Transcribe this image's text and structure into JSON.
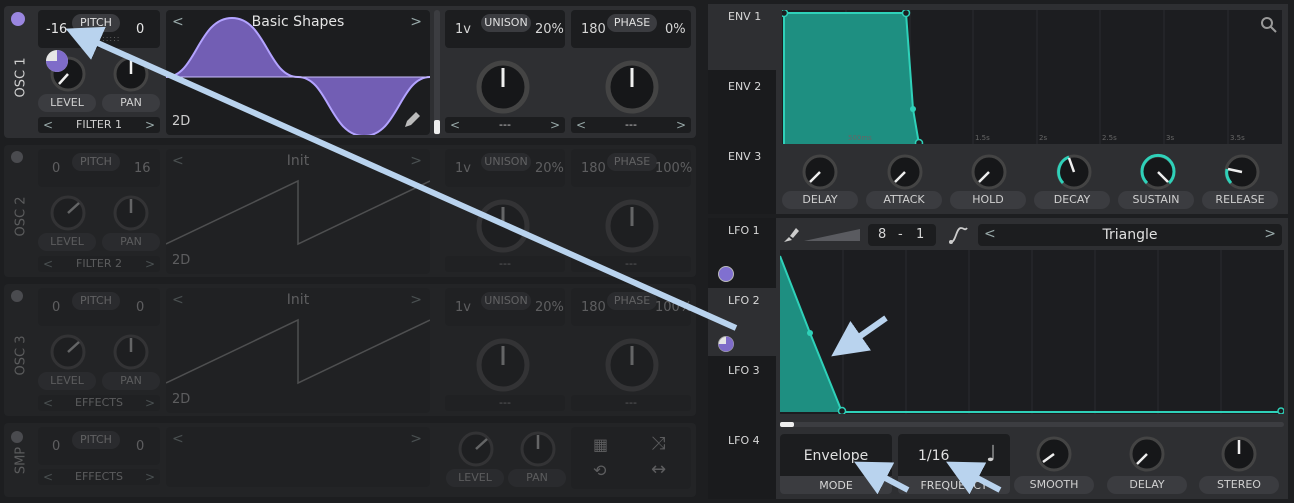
{
  "osc1": {
    "side_label": "OSC 1",
    "pitch_label": "PITCH",
    "pitch_left": "-16",
    "pitch_right": "0",
    "level_label": "LEVEL",
    "pan_label": "PAN",
    "dest": "FILTER 1",
    "wavetable_name": "Basic Shapes",
    "mode": "2D",
    "unison_label": "UNISON",
    "unison_voices": "1v",
    "unison_detune": "20%",
    "phase_label": "PHASE",
    "phase_value": "180",
    "phase_random": "0%",
    "sel1": "---",
    "sel2": "---"
  },
  "osc2": {
    "side_label": "OSC 2",
    "pitch_label": "PITCH",
    "pitch_left": "0",
    "pitch_right": "16",
    "level_label": "LEVEL",
    "pan_label": "PAN",
    "dest": "FILTER 2",
    "wavetable_name": "Init",
    "mode": "2D",
    "unison_label": "UNISON",
    "unison_voices": "1v",
    "unison_detune": "20%",
    "phase_label": "PHASE",
    "phase_value": "180",
    "phase_random": "100%",
    "sel1": "---",
    "sel2": "---"
  },
  "osc3": {
    "side_label": "OSC 3",
    "pitch_label": "PITCH",
    "pitch_left": "0",
    "pitch_right": "0",
    "level_label": "LEVEL",
    "pan_label": "PAN",
    "dest": "EFFECTS",
    "wavetable_name": "Init",
    "mode": "2D",
    "unison_label": "UNISON",
    "unison_voices": "1v",
    "unison_detune": "20%",
    "phase_label": "PHASE",
    "phase_value": "180",
    "phase_random": "100%",
    "sel1": "---",
    "sel2": "---"
  },
  "smp": {
    "side_label": "SMP",
    "pitch_label": "PITCH",
    "pitch_left": "0",
    "pitch_right": "0",
    "level_label": "LEVEL",
    "pan_label": "PAN",
    "dest": "EFFECTS"
  },
  "env": {
    "tabs": [
      "ENV 1",
      "ENV 2",
      "ENV 3"
    ],
    "time_marks": [
      "500ms",
      "1.5s",
      "2s",
      "2.5s",
      "3s",
      "3.5s"
    ],
    "knobs": [
      "DELAY",
      "ATTACK",
      "HOLD",
      "DECAY",
      "SUSTAIN",
      "RELEASE"
    ]
  },
  "lfo": {
    "tabs": [
      "LFO 1",
      "LFO 2",
      "LFO 3",
      "LFO 4"
    ],
    "grid_num": "8",
    "grid_sep": "-",
    "grid_den": "1",
    "shape_name": "Triangle",
    "mode_value": "Envelope",
    "mode_label": "MODE",
    "frequency_value": "1/16",
    "frequency_label": "FREQUENCY",
    "knobs": [
      "SMOOTH",
      "DELAY",
      "STEREO"
    ]
  },
  "colors": {
    "accent_purple": "#8e7bd6",
    "accent_teal": "#2fd1b9",
    "annotation_arrow": "#b9d3ee"
  }
}
